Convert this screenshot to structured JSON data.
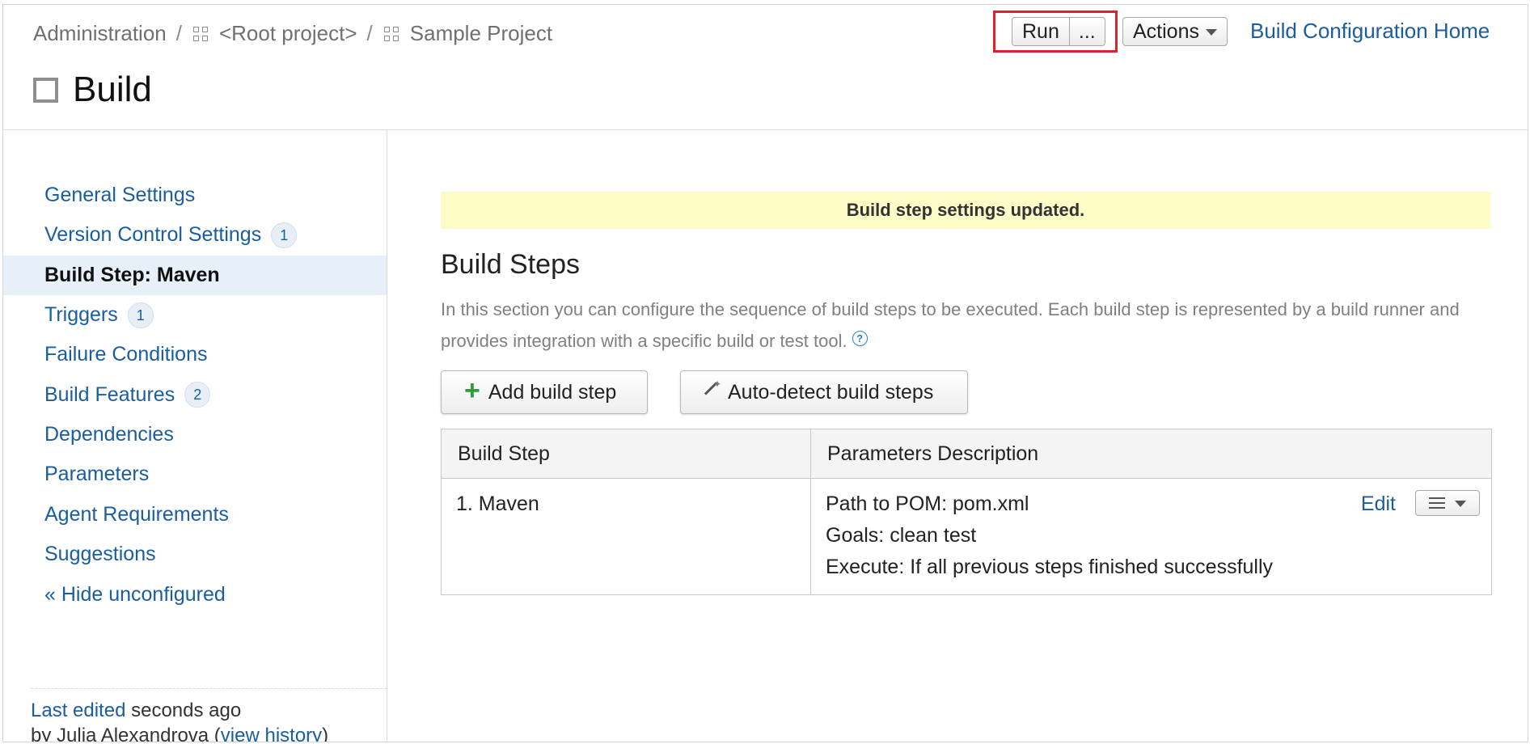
{
  "breadcrumb": {
    "items": [
      "Administration",
      "<Root project>",
      "Sample Project"
    ],
    "separator": "/"
  },
  "page_title": "Build",
  "toolbar": {
    "run_label": "Run",
    "more_label": "...",
    "actions_label": "Actions",
    "home_link": "Build Configuration Home"
  },
  "sidebar": {
    "items": [
      {
        "label": "General Settings",
        "badge": ""
      },
      {
        "label": "Version Control Settings",
        "badge": "1"
      },
      {
        "label": "Build Step: Maven",
        "badge": "",
        "active": true
      },
      {
        "label": "Triggers",
        "badge": "1"
      },
      {
        "label": "Failure Conditions",
        "badge": ""
      },
      {
        "label": "Build Features",
        "badge": "2"
      },
      {
        "label": "Dependencies",
        "badge": ""
      },
      {
        "label": "Parameters",
        "badge": ""
      },
      {
        "label": "Agent Requirements",
        "badge": ""
      },
      {
        "label": "Suggestions",
        "badge": ""
      }
    ],
    "hide_link": "« Hide unconfigured",
    "last_edited": {
      "link": "Last edited",
      "when": " seconds ago",
      "by": "by Julia Alexandrova  (",
      "history_link": "view history",
      "close": ")"
    }
  },
  "main": {
    "notice": "Build step settings updated.",
    "section_title": "Build Steps",
    "description": "In this section you can configure the sequence of build steps to be executed. Each build step is represented by a build runner and provides integration with a specific build or test tool.",
    "help_icon_glyph": "?",
    "add_button": "Add build step",
    "auto_button": "Auto-detect build steps",
    "table": {
      "headers": [
        "Build Step",
        "Parameters Description"
      ],
      "rows": [
        {
          "step": "1. Maven",
          "params": [
            "Path to POM: pom.xml",
            "Goals: clean test",
            "Execute: If all previous steps finished successfully"
          ],
          "edit": "Edit"
        }
      ]
    }
  },
  "colors": {
    "link": "#1a5da0",
    "highlight": "#e0202a",
    "notice_bg": "#fdfcc6",
    "active_bg": "#e7f0f9",
    "plus": "#2a9d3a"
  }
}
